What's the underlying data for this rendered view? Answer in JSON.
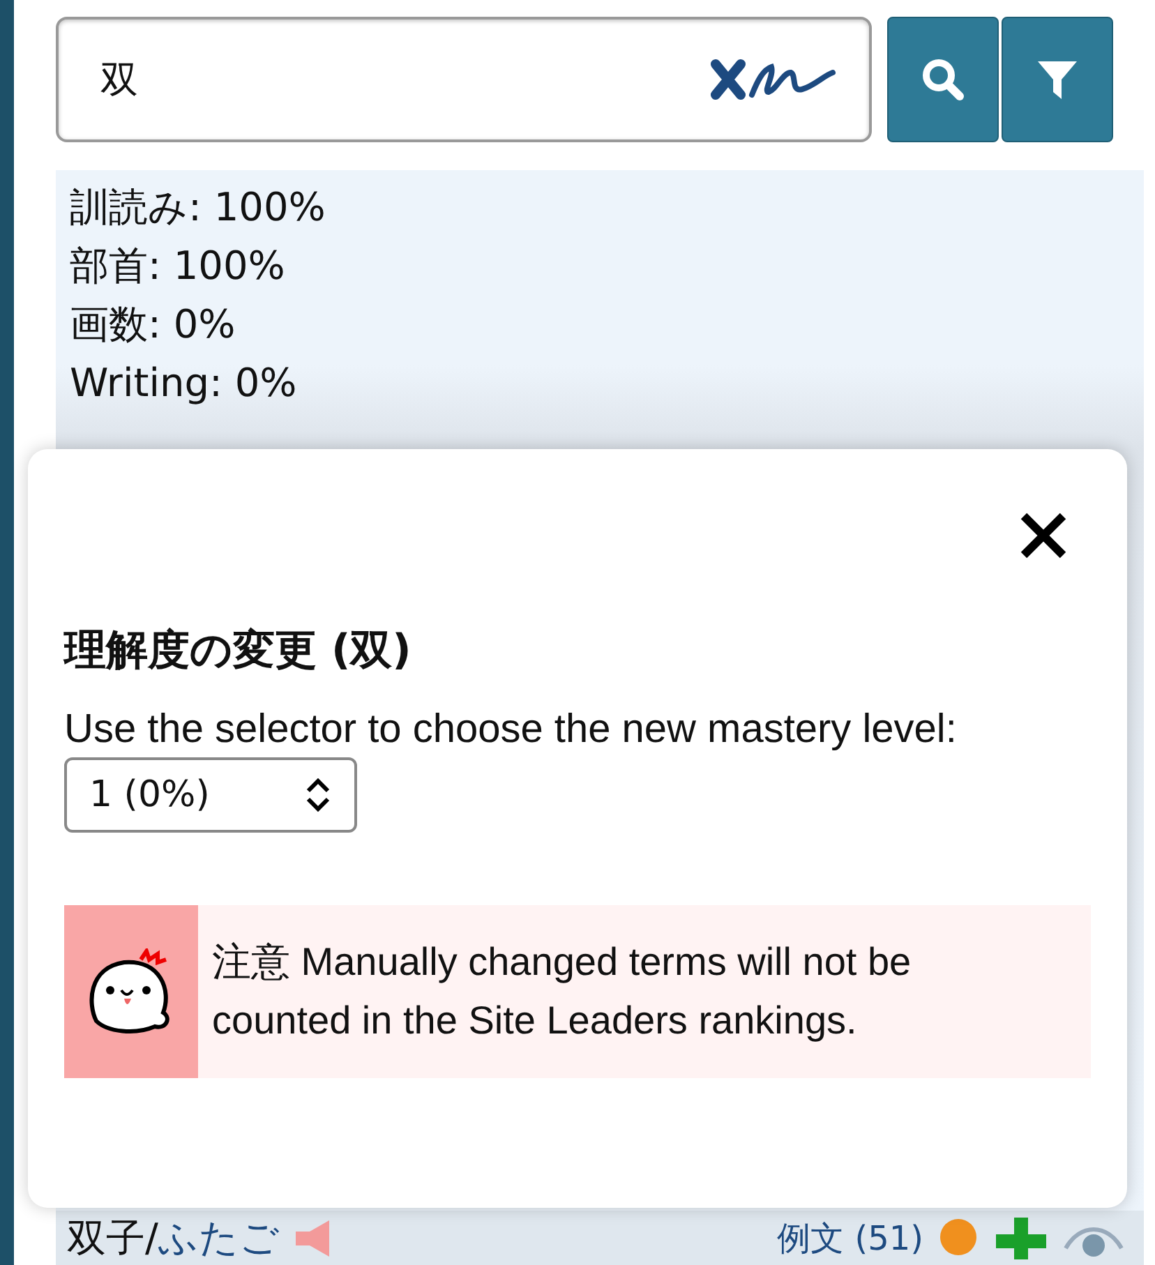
{
  "search": {
    "value": "双"
  },
  "stats": {
    "lines": [
      "訓読み: 100%",
      "部首: 100%",
      "画数: 0%",
      "Writing: 0%"
    ]
  },
  "modal": {
    "title": "理解度の変更 (双)",
    "instruction": "Use the selector to choose the new mastery level:",
    "selector": {
      "value": "1 (0%)"
    },
    "notice": {
      "label": "注意",
      "text": "Manually changed terms will not be counted in the Site Leaders rankings."
    }
  },
  "word_row": {
    "word": "双子/",
    "reading": "ふたご",
    "examples_link": "例文 (51)"
  }
}
